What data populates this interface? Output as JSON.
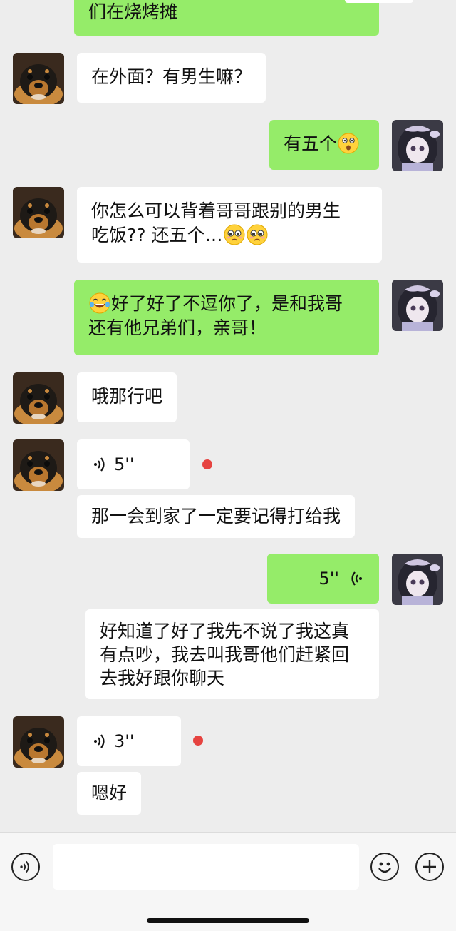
{
  "chat": {
    "partial_top_text": "们在烧烤摊",
    "msg_outside": "在外面？有男生嘛？",
    "msg_five": "有五个",
    "msg_how_line1": "你怎么可以背着哥哥跟别的男生",
    "msg_how_line2": "吃饭?? 还五个…",
    "msg_ok_line1": "好了好了不逗你了，是和我哥",
    "msg_ok_line2": "还有他兄弟们，亲哥！",
    "msg_fine": "哦那行吧",
    "voice_left_1": "5''",
    "msg_call": "那一会到家了一定要记得打给我",
    "voice_right_1": "5''",
    "msg_know_line1": "好知道了好了我先不说了我这真",
    "msg_know_line2": "有点吵，我去叫我哥他们赶紧回",
    "msg_know_line3": "去我好跟你聊天",
    "voice_left_2": "3''",
    "msg_good": "嗯好"
  },
  "input": {
    "value": ""
  },
  "icons": {
    "voice_toggle": "voice-icon",
    "emoji": "emoji-icon",
    "plus": "plus-icon"
  },
  "colors": {
    "background": "#ededed",
    "bubble_sent": "#95ec69",
    "bubble_received": "#ffffff",
    "unread_dot": "#e64340"
  }
}
